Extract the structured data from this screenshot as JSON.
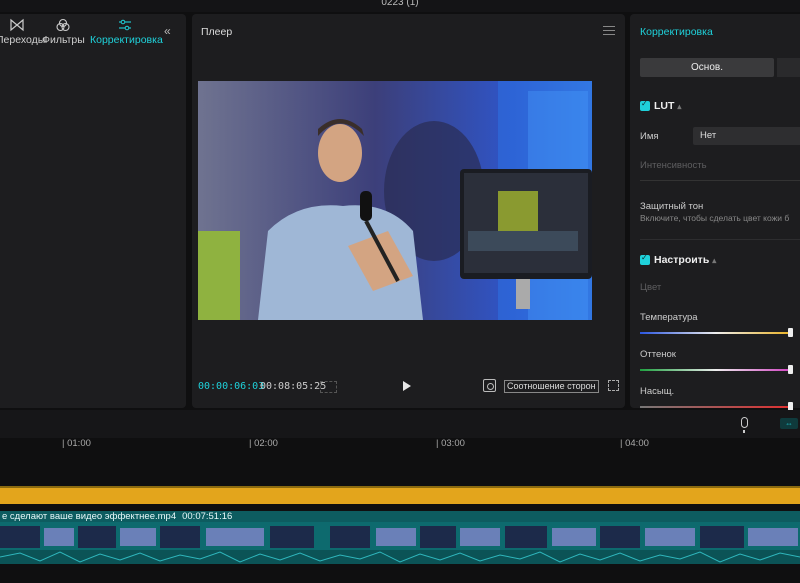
{
  "window": {
    "title": "0223 (1)"
  },
  "left_panel": {
    "tabs": [
      {
        "label": "Переходы",
        "icon": "transitions-icon"
      },
      {
        "label": "Фильтры",
        "icon": "filters-icon"
      },
      {
        "label": "Корректировка",
        "icon": "adjust-icon",
        "active": true
      }
    ],
    "collapse_icon": "double-chevron-left-icon"
  },
  "player": {
    "title": "Плеер",
    "current_time": "00:00:06:03",
    "total_time": "00:08:05:25",
    "aspect_label": "Соотношение сторон"
  },
  "right_panel": {
    "title": "Корректировка",
    "segment_label": "Основ.",
    "lut": {
      "label": "LUT",
      "name_label": "Имя",
      "name_value": "Нет",
      "intensity_label": "Интенсивность"
    },
    "skin": {
      "label": "Защитный тон",
      "hint": "Включите, чтобы сделать цвет кожи б"
    },
    "adjust": {
      "label": "Настроить",
      "color_label": "Цвет",
      "temperature_label": "Температура",
      "temperature_value": 0.97,
      "tint_label": "Оттенок",
      "tint_value": 0.97,
      "saturation_label": "Насыщ.",
      "saturation_value": 0.97
    }
  },
  "timeline": {
    "ticks": [
      "| 01:00",
      "| 02:00",
      "| 03:00",
      "| 04:00"
    ],
    "clip_name": "е сделают ваше видео эффектнее.mp4",
    "clip_duration": "00:07:51:16"
  },
  "colors": {
    "accent": "#1fd1da",
    "track": "#0d6a6e",
    "audio": "#e3a51c"
  }
}
